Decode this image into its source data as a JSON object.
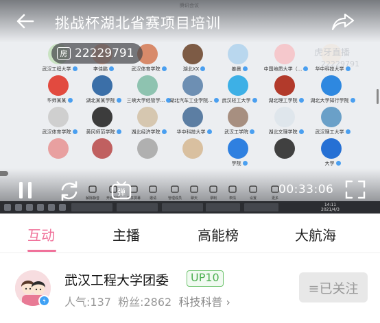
{
  "video": {
    "title": "挑战杯湖北省赛项目培训",
    "room": {
      "tag": "房",
      "number": "22229791"
    },
    "watermark": {
      "brand": "虎牙直播",
      "room": "22229791"
    },
    "timer": "00:33:06",
    "participants": [
      "武汉工程大学",
      "李佳鹏",
      "武汉体育学院",
      "湖北XX",
      "姜晨",
      "中国地质大学（...",
      "华中科技大学",
      "华师某某",
      "湖北某某学院",
      "三峡大学经管学...",
      "湖北汽车工业学院...",
      "武汉轻工大学",
      "湖北理工学院",
      "湖北大学知行学院",
      "武汉体育学院",
      "黄冈师范学院",
      "湖北经济学院",
      "华中科技大学",
      "武汉工学院",
      "湖北文理学院",
      "武汉理工大学",
      "",
      "",
      "",
      "",
      "学院",
      "",
      "大学"
    ],
    "meeting_tools": [
      "解除静音",
      "开启视频",
      "共享屏幕",
      "邀请",
      "管理成员",
      "聊天",
      "录制",
      "表情",
      "设置",
      "更多"
    ],
    "clock": {
      "time": "14:11",
      "date": "2021/4/3"
    }
  },
  "tabs": [
    {
      "label": "互动",
      "active": true
    },
    {
      "label": "主播",
      "active": false
    },
    {
      "label": "高能榜",
      "active": false
    },
    {
      "label": "大航海",
      "active": false
    }
  ],
  "streamer": {
    "name": "武汉工程大学团委",
    "level": "UP10",
    "popularity": "人气:137",
    "fans": "粉丝:2862",
    "category": "科技科普",
    "follow_label": "≡已关注"
  },
  "colors": {
    "accent": "#f0719a",
    "level_green": "#4caf50",
    "badge_blue": "#3fa1f5"
  }
}
